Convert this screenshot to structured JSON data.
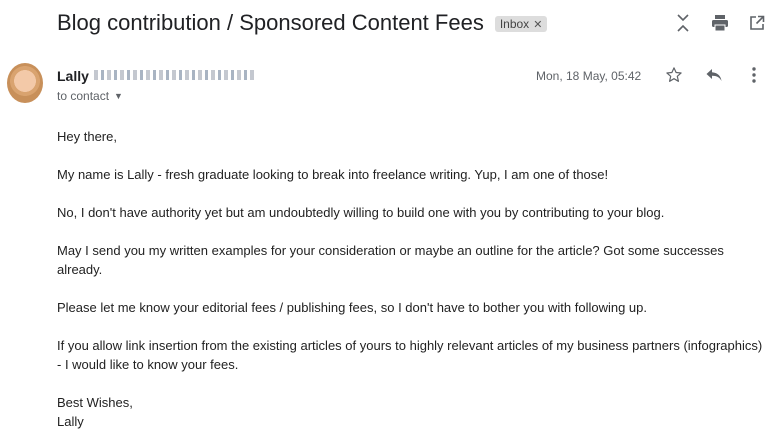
{
  "email": {
    "subject": "Blog contribution / Sponsored Content Fees",
    "label": "Inbox",
    "sender_name": "Lally",
    "to": "to contact",
    "date": "Mon, 18 May, 05:42"
  },
  "icons": {
    "top": [
      "expand-collapse-icon",
      "print-icon",
      "open-new-window-icon"
    ],
    "message": [
      "star-icon",
      "reply-icon",
      "more-vert-icon"
    ]
  },
  "body": {
    "greeting": "Hey there,",
    "p1": "My name is Lally - fresh graduate looking to break into freelance writing. Yup, I am one of those!",
    "p2": "No, I don't have authority yet but am undoubtedly willing to build one with you by contributing to your blog.",
    "p3": "May I send you my written examples for your consideration or maybe an outline for the article? Got some successes already.",
    "p4": "Please let me know your editorial fees / publishing fees, so I don't have to bother you with following up.",
    "p5": "If you allow link insertion from the existing articles of yours to highly relevant articles of my business partners (infographics) - I would like to know your fees.",
    "closing": "Best Wishes,",
    "signature": "Lally"
  }
}
